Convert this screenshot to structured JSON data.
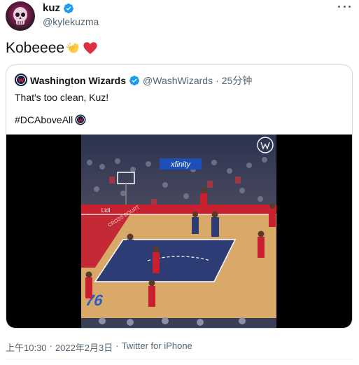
{
  "author": {
    "display_name": "kuz",
    "handle": "@kylekuzma",
    "verified": true,
    "avatar_icon": "skull-avatar-icon"
  },
  "tweet": {
    "text": "Kobeeee",
    "emojis": [
      "clapping-hands-emoji",
      "red-heart-emoji"
    ]
  },
  "quoted_tweet": {
    "display_name": "Washington Wizards",
    "handle": "@WashWizards",
    "separator": "·",
    "time": "25分钟",
    "text": "That's too clean, Kuz!",
    "hashtag": "#DCAboveAll",
    "media": {
      "type": "video",
      "overlay_brand": "xfinity",
      "court_logo": "76",
      "sign_text": "CROSS COURT",
      "ad_text": "Lidl"
    }
  },
  "footer": {
    "time": "上午10:30",
    "separator": "·",
    "date": "2022年2月3日",
    "source": "Twitter for iPhone"
  },
  "colors": {
    "verified_blue": "#1d9bf0",
    "secondary_text": "#536471",
    "border": "#cfd9de",
    "heart_red": "#f91880"
  }
}
